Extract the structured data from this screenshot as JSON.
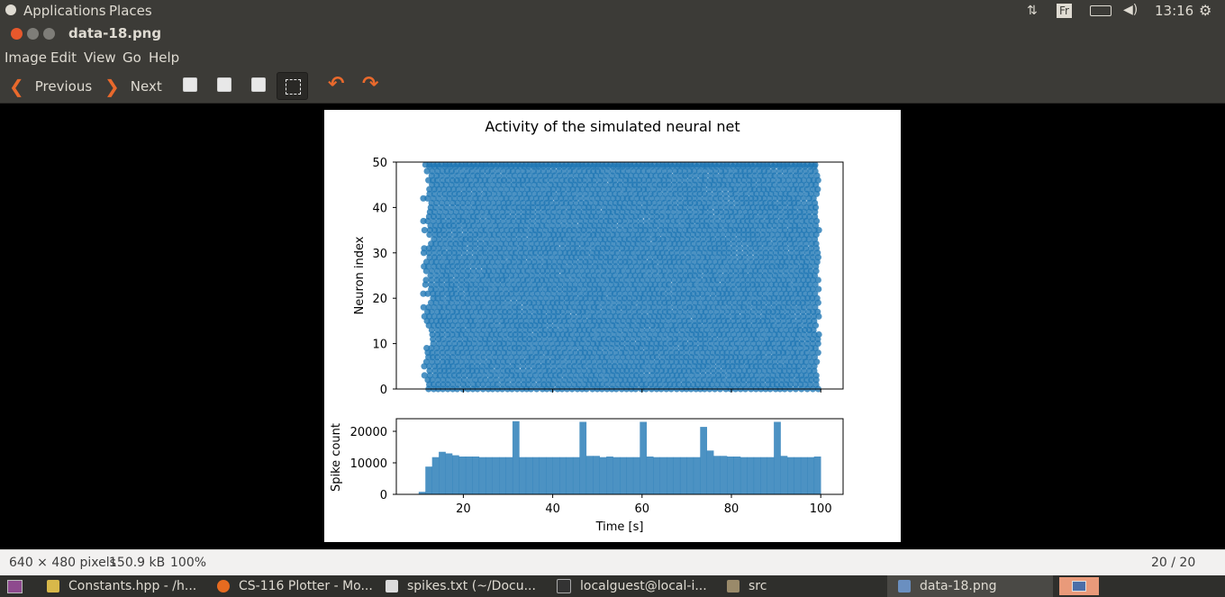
{
  "topbar": {
    "applications": "Applications",
    "places": "Places",
    "keyboard": "Fr",
    "clock": "13:16"
  },
  "window": {
    "title": "data-18.png"
  },
  "menu": {
    "items": [
      "Image",
      "Edit",
      "View",
      "Go",
      "Help"
    ]
  },
  "toolbar": {
    "previous": "Previous",
    "next": "Next"
  },
  "chart_data": [
    {
      "type": "scatter",
      "title": "Activity of the simulated neural net",
      "xlabel": "",
      "ylabel": "Neuron index",
      "xlim": [
        5,
        105
      ],
      "ylim": [
        0,
        50
      ],
      "yticks": [
        "0",
        "10",
        "20",
        "30",
        "40",
        "50"
      ],
      "color": "#1f77b4",
      "description_of_data": "dense regular spike raster for neurons 0-49 from ~11 s to ~100 s"
    },
    {
      "type": "bar",
      "xlabel": "Time [s]",
      "ylabel": "Spike count",
      "xlim": [
        5,
        105
      ],
      "ylim": [
        0,
        24000
      ],
      "xticks": [
        "20",
        "40",
        "60",
        "80",
        "100"
      ],
      "yticks": [
        "0",
        "10000",
        "20000"
      ],
      "color": "#1f77b4",
      "bins_start": 10,
      "bin_width": 1.5,
      "values": [
        800,
        8800,
        11800,
        13500,
        13000,
        12400,
        12000,
        12000,
        12000,
        11800,
        11800,
        11800,
        11800,
        11800,
        23200,
        11800,
        11800,
        11800,
        11800,
        11800,
        11800,
        11800,
        11800,
        11800,
        23000,
        12200,
        12200,
        11800,
        12000,
        11800,
        11800,
        11800,
        11800,
        23000,
        12000,
        11800,
        11800,
        11800,
        11800,
        11800,
        11800,
        11800,
        21400,
        13900,
        12200,
        12200,
        12000,
        12000,
        11800,
        11800,
        11800,
        11800,
        11800,
        23000,
        12200,
        11800,
        11800,
        11800,
        11800,
        12000
      ]
    }
  ],
  "status": {
    "dimensions": "640 × 480 pixels",
    "size": "150.9 kB",
    "zoom": "100%",
    "position": "20 / 20"
  },
  "taskbar": {
    "items": [
      "Constants.hpp - /h...",
      "CS-116 Plotter - Mo...",
      "spikes.txt (~/Docu...",
      "localguest@local-i...",
      "src",
      "data-18.png"
    ]
  }
}
